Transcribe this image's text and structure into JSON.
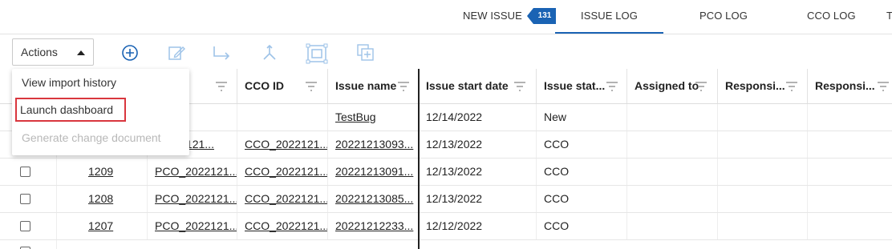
{
  "nav": {
    "new_issue": "NEW ISSUE",
    "badge_count": "131",
    "issue_log": "ISSUE LOG",
    "pco_log": "PCO LOG",
    "cco_log": "CCO LOG",
    "more": "T"
  },
  "toolbar": {
    "actions_label": "Actions",
    "icons": [
      "add-circle-icon",
      "edit-icon",
      "move-to-icon",
      "merge-icon",
      "select-frame-icon",
      "duplicate-icon"
    ]
  },
  "menu": {
    "items": [
      {
        "label": "View import history",
        "enabled": true
      },
      {
        "label": "Launch dashboard",
        "enabled": true,
        "highlighted": true
      },
      {
        "label": "Generate change document",
        "enabled": false
      }
    ]
  },
  "grid": {
    "columns": [
      "CCO ID",
      "Issue name",
      "Issue start date",
      "Issue stat...",
      "Assigned to",
      "Responsi...",
      "Responsi..."
    ],
    "rows": [
      {
        "id": "",
        "pco": "",
        "cco": "",
        "name": "TestBug",
        "date": "12/14/2022",
        "status": "New"
      },
      {
        "id": "",
        "pco": "_2022121...",
        "cco": "CCO_2022121...",
        "name": "20221213093...",
        "date": "12/13/2022",
        "status": "CCO"
      },
      {
        "id": "1209",
        "pco": "PCO_2022121...",
        "cco": "CCO_2022121...",
        "name": "20221213091...",
        "date": "12/13/2022",
        "status": "CCO"
      },
      {
        "id": "1208",
        "pco": "PCO_2022121...",
        "cco": "CCO_2022121...",
        "name": "20221213085...",
        "date": "12/13/2022",
        "status": "CCO"
      },
      {
        "id": "1207",
        "pco": "PCO_2022121...",
        "cco": "CCO_2022121...",
        "name": "20221212233...",
        "date": "12/12/2022",
        "status": "CCO"
      }
    ]
  },
  "colors": {
    "accent": "#1a63b4",
    "highlight": "#d9363e"
  }
}
